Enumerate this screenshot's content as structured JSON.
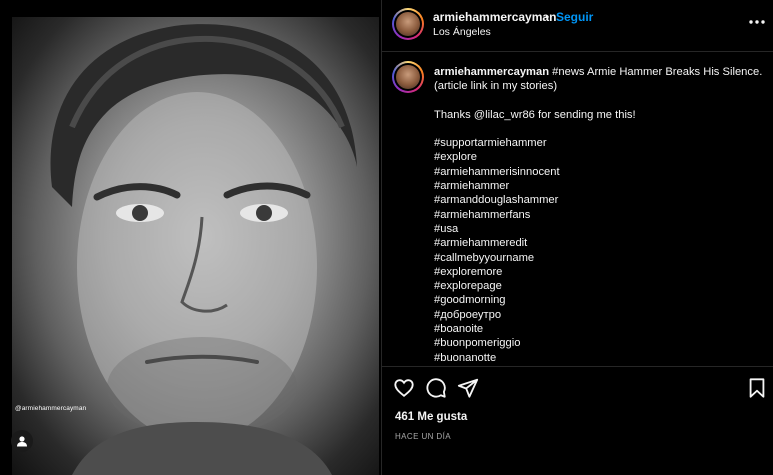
{
  "post": {
    "watermark": "@armiehammercayman"
  },
  "header": {
    "username": "armiehammercayman",
    "separator": "•",
    "follow_label": "Seguir",
    "location": "Los Ángeles"
  },
  "caption": {
    "author": "armiehammercayman",
    "text_line1": " #news Armie Hammer Breaks His Silence.",
    "text_line2": "(article link in my stories)",
    "thanks": "Thanks @lilac_wr86 for sending me this!",
    "hashtags": [
      "#supportarmiehammer",
      "#explore",
      "#armiehammerisinnocent",
      "#armiehammer",
      "#armanddouglashammer",
      "#armiehammerfans",
      "#usa",
      "#armiehammeredit",
      "#callmebyyourname",
      "#exploremore",
      "#explorepage",
      "#goodmorning",
      "#доброеутро",
      "#boanoite",
      "#buonpomeriggio",
      "#buonanotte"
    ]
  },
  "actions": {
    "likes": "461 Me gusta",
    "time": "HACE UN DÍA"
  },
  "icons": {
    "more": "more-options-icon",
    "like": "heart-icon",
    "comment": "comment-icon",
    "share": "share-icon",
    "save": "bookmark-icon",
    "tag": "user-tag-icon"
  },
  "colors": {
    "accent": "#0095f6",
    "background": "#000000",
    "divider": "#262626",
    "muted": "#a8a8a8"
  }
}
